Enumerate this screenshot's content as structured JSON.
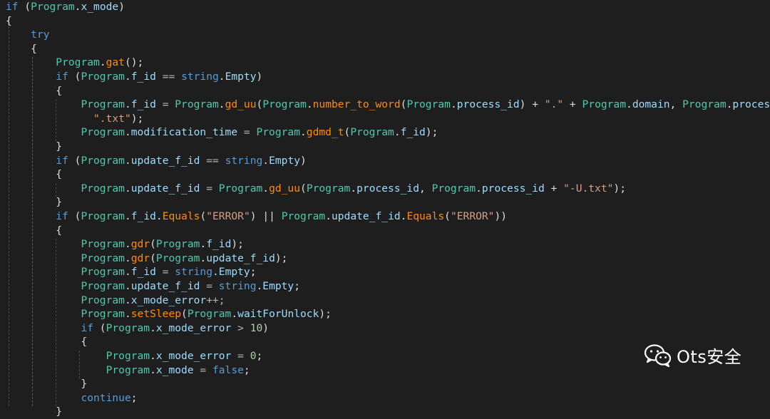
{
  "code_lines": [
    [
      {
        "t": "if",
        "c": "kw"
      },
      {
        "t": " (",
        "c": "pl"
      },
      {
        "t": "Program",
        "c": "id"
      },
      {
        "t": ".",
        "c": "pl"
      },
      {
        "t": "x_mode",
        "c": "fld"
      },
      {
        "t": ")",
        "c": "pl"
      }
    ],
    [
      {
        "t": "{",
        "c": "pl"
      }
    ],
    [
      {
        "t": "    ",
        "c": "pl"
      },
      {
        "t": "try",
        "c": "kw"
      }
    ],
    [
      {
        "t": "    {",
        "c": "pl"
      }
    ],
    [
      {
        "t": "        ",
        "c": "pl"
      },
      {
        "t": "Program",
        "c": "id"
      },
      {
        "t": ".",
        "c": "pl"
      },
      {
        "t": "gat",
        "c": "mth"
      },
      {
        "t": "();",
        "c": "pl"
      }
    ],
    [
      {
        "t": "        ",
        "c": "pl"
      },
      {
        "t": "if",
        "c": "kw"
      },
      {
        "t": " (",
        "c": "pl"
      },
      {
        "t": "Program",
        "c": "id"
      },
      {
        "t": ".",
        "c": "pl"
      },
      {
        "t": "f_id",
        "c": "fld"
      },
      {
        "t": " == ",
        "c": "op"
      },
      {
        "t": "string",
        "c": "kw"
      },
      {
        "t": ".",
        "c": "pl"
      },
      {
        "t": "Empty",
        "c": "fld"
      },
      {
        "t": ")",
        "c": "pl"
      }
    ],
    [
      {
        "t": "        {",
        "c": "pl"
      }
    ],
    [
      {
        "t": "            ",
        "c": "pl"
      },
      {
        "t": "Program",
        "c": "id"
      },
      {
        "t": ".",
        "c": "pl"
      },
      {
        "t": "f_id",
        "c": "fld"
      },
      {
        "t": " = ",
        "c": "op"
      },
      {
        "t": "Program",
        "c": "id"
      },
      {
        "t": ".",
        "c": "pl"
      },
      {
        "t": "gd_uu",
        "c": "mth"
      },
      {
        "t": "(",
        "c": "pl"
      },
      {
        "t": "Program",
        "c": "id"
      },
      {
        "t": ".",
        "c": "pl"
      },
      {
        "t": "number_to_word",
        "c": "mth"
      },
      {
        "t": "(",
        "c": "pl"
      },
      {
        "t": "Program",
        "c": "id"
      },
      {
        "t": ".",
        "c": "pl"
      },
      {
        "t": "process_id",
        "c": "fld"
      },
      {
        "t": ") + ",
        "c": "pl"
      },
      {
        "t": "\".\"",
        "c": "str"
      },
      {
        "t": " + ",
        "c": "pl"
      },
      {
        "t": "Program",
        "c": "id"
      },
      {
        "t": ".",
        "c": "pl"
      },
      {
        "t": "domain",
        "c": "fld"
      },
      {
        "t": ", ",
        "c": "pl"
      },
      {
        "t": "Program",
        "c": "id"
      },
      {
        "t": ".",
        "c": "pl"
      },
      {
        "t": "process_id",
        "c": "fld"
      },
      {
        "t": " +",
        "c": "pl"
      }
    ],
    [
      {
        "t": "              ",
        "c": "pl"
      },
      {
        "t": "\".txt\"",
        "c": "str"
      },
      {
        "t": ");",
        "c": "pl"
      }
    ],
    [
      {
        "t": "            ",
        "c": "pl"
      },
      {
        "t": "Program",
        "c": "id"
      },
      {
        "t": ".",
        "c": "pl"
      },
      {
        "t": "modification_time",
        "c": "fld"
      },
      {
        "t": " = ",
        "c": "op"
      },
      {
        "t": "Program",
        "c": "id"
      },
      {
        "t": ".",
        "c": "pl"
      },
      {
        "t": "gdmd_t",
        "c": "mth"
      },
      {
        "t": "(",
        "c": "pl"
      },
      {
        "t": "Program",
        "c": "id"
      },
      {
        "t": ".",
        "c": "pl"
      },
      {
        "t": "f_id",
        "c": "fld"
      },
      {
        "t": ");",
        "c": "pl"
      }
    ],
    [
      {
        "t": "        }",
        "c": "pl"
      }
    ],
    [
      {
        "t": "        ",
        "c": "pl"
      },
      {
        "t": "if",
        "c": "kw"
      },
      {
        "t": " (",
        "c": "pl"
      },
      {
        "t": "Program",
        "c": "id"
      },
      {
        "t": ".",
        "c": "pl"
      },
      {
        "t": "update_f_id",
        "c": "fld"
      },
      {
        "t": " == ",
        "c": "op"
      },
      {
        "t": "string",
        "c": "kw"
      },
      {
        "t": ".",
        "c": "pl"
      },
      {
        "t": "Empty",
        "c": "fld"
      },
      {
        "t": ")",
        "c": "pl"
      }
    ],
    [
      {
        "t": "        {",
        "c": "pl"
      }
    ],
    [
      {
        "t": "            ",
        "c": "pl"
      },
      {
        "t": "Program",
        "c": "id"
      },
      {
        "t": ".",
        "c": "pl"
      },
      {
        "t": "update_f_id",
        "c": "fld"
      },
      {
        "t": " = ",
        "c": "op"
      },
      {
        "t": "Program",
        "c": "id"
      },
      {
        "t": ".",
        "c": "pl"
      },
      {
        "t": "gd_uu",
        "c": "mth"
      },
      {
        "t": "(",
        "c": "pl"
      },
      {
        "t": "Program",
        "c": "id"
      },
      {
        "t": ".",
        "c": "pl"
      },
      {
        "t": "process_id",
        "c": "fld"
      },
      {
        "t": ", ",
        "c": "pl"
      },
      {
        "t": "Program",
        "c": "id"
      },
      {
        "t": ".",
        "c": "pl"
      },
      {
        "t": "process_id",
        "c": "fld"
      },
      {
        "t": " + ",
        "c": "pl"
      },
      {
        "t": "\"-U.txt\"",
        "c": "str"
      },
      {
        "t": ");",
        "c": "pl"
      }
    ],
    [
      {
        "t": "        }",
        "c": "pl"
      }
    ],
    [
      {
        "t": "        ",
        "c": "pl"
      },
      {
        "t": "if",
        "c": "kw"
      },
      {
        "t": " (",
        "c": "pl"
      },
      {
        "t": "Program",
        "c": "id"
      },
      {
        "t": ".",
        "c": "pl"
      },
      {
        "t": "f_id",
        "c": "fld"
      },
      {
        "t": ".",
        "c": "pl"
      },
      {
        "t": "Equals",
        "c": "mth"
      },
      {
        "t": "(",
        "c": "pl"
      },
      {
        "t": "\"ERROR\"",
        "c": "str"
      },
      {
        "t": ") || ",
        "c": "pl"
      },
      {
        "t": "Program",
        "c": "id"
      },
      {
        "t": ".",
        "c": "pl"
      },
      {
        "t": "update_f_id",
        "c": "fld"
      },
      {
        "t": ".",
        "c": "pl"
      },
      {
        "t": "Equals",
        "c": "mth"
      },
      {
        "t": "(",
        "c": "pl"
      },
      {
        "t": "\"ERROR\"",
        "c": "str"
      },
      {
        "t": "))",
        "c": "pl"
      }
    ],
    [
      {
        "t": "        {",
        "c": "pl"
      }
    ],
    [
      {
        "t": "            ",
        "c": "pl"
      },
      {
        "t": "Program",
        "c": "id"
      },
      {
        "t": ".",
        "c": "pl"
      },
      {
        "t": "gdr",
        "c": "mth"
      },
      {
        "t": "(",
        "c": "pl"
      },
      {
        "t": "Program",
        "c": "id"
      },
      {
        "t": ".",
        "c": "pl"
      },
      {
        "t": "f_id",
        "c": "fld"
      },
      {
        "t": ");",
        "c": "pl"
      }
    ],
    [
      {
        "t": "            ",
        "c": "pl"
      },
      {
        "t": "Program",
        "c": "id"
      },
      {
        "t": ".",
        "c": "pl"
      },
      {
        "t": "gdr",
        "c": "mth"
      },
      {
        "t": "(",
        "c": "pl"
      },
      {
        "t": "Program",
        "c": "id"
      },
      {
        "t": ".",
        "c": "pl"
      },
      {
        "t": "update_f_id",
        "c": "fld"
      },
      {
        "t": ");",
        "c": "pl"
      }
    ],
    [
      {
        "t": "            ",
        "c": "pl"
      },
      {
        "t": "Program",
        "c": "id"
      },
      {
        "t": ".",
        "c": "pl"
      },
      {
        "t": "f_id",
        "c": "fld"
      },
      {
        "t": " = ",
        "c": "op"
      },
      {
        "t": "string",
        "c": "kw"
      },
      {
        "t": ".",
        "c": "pl"
      },
      {
        "t": "Empty",
        "c": "fld"
      },
      {
        "t": ";",
        "c": "pl"
      }
    ],
    [
      {
        "t": "            ",
        "c": "pl"
      },
      {
        "t": "Program",
        "c": "id"
      },
      {
        "t": ".",
        "c": "pl"
      },
      {
        "t": "update_f_id",
        "c": "fld"
      },
      {
        "t": " = ",
        "c": "op"
      },
      {
        "t": "string",
        "c": "kw"
      },
      {
        "t": ".",
        "c": "pl"
      },
      {
        "t": "Empty",
        "c": "fld"
      },
      {
        "t": ";",
        "c": "pl"
      }
    ],
    [
      {
        "t": "            ",
        "c": "pl"
      },
      {
        "t": "Program",
        "c": "id"
      },
      {
        "t": ".",
        "c": "pl"
      },
      {
        "t": "x_mode_error",
        "c": "fld"
      },
      {
        "t": "++;",
        "c": "op"
      }
    ],
    [
      {
        "t": "            ",
        "c": "pl"
      },
      {
        "t": "Program",
        "c": "id"
      },
      {
        "t": ".",
        "c": "pl"
      },
      {
        "t": "setSleep",
        "c": "mth"
      },
      {
        "t": "(",
        "c": "pl"
      },
      {
        "t": "Program",
        "c": "id"
      },
      {
        "t": ".",
        "c": "pl"
      },
      {
        "t": "waitForUnlock",
        "c": "fld"
      },
      {
        "t": ");",
        "c": "pl"
      }
    ],
    [
      {
        "t": "            ",
        "c": "pl"
      },
      {
        "t": "if",
        "c": "kw"
      },
      {
        "t": " (",
        "c": "pl"
      },
      {
        "t": "Program",
        "c": "id"
      },
      {
        "t": ".",
        "c": "pl"
      },
      {
        "t": "x_mode_error",
        "c": "fld"
      },
      {
        "t": " > ",
        "c": "op"
      },
      {
        "t": "10",
        "c": "num"
      },
      {
        "t": ")",
        "c": "pl"
      }
    ],
    [
      {
        "t": "            {",
        "c": "pl"
      }
    ],
    [
      {
        "t": "                ",
        "c": "pl"
      },
      {
        "t": "Program",
        "c": "id"
      },
      {
        "t": ".",
        "c": "pl"
      },
      {
        "t": "x_mode_error",
        "c": "fld"
      },
      {
        "t": " = ",
        "c": "op"
      },
      {
        "t": "0",
        "c": "num"
      },
      {
        "t": ";",
        "c": "pl"
      }
    ],
    [
      {
        "t": "                ",
        "c": "pl"
      },
      {
        "t": "Program",
        "c": "id"
      },
      {
        "t": ".",
        "c": "pl"
      },
      {
        "t": "x_mode",
        "c": "fld"
      },
      {
        "t": " = ",
        "c": "op"
      },
      {
        "t": "false",
        "c": "kw"
      },
      {
        "t": ";",
        "c": "pl"
      }
    ],
    [
      {
        "t": "            }",
        "c": "pl"
      }
    ],
    [
      {
        "t": "            ",
        "c": "pl"
      },
      {
        "t": "continue",
        "c": "kw"
      },
      {
        "t": ";",
        "c": "pl"
      }
    ],
    [
      {
        "t": "        }",
        "c": "pl"
      }
    ]
  ],
  "watermark": {
    "icon": "wechat-icon",
    "text": "Ots安全"
  }
}
